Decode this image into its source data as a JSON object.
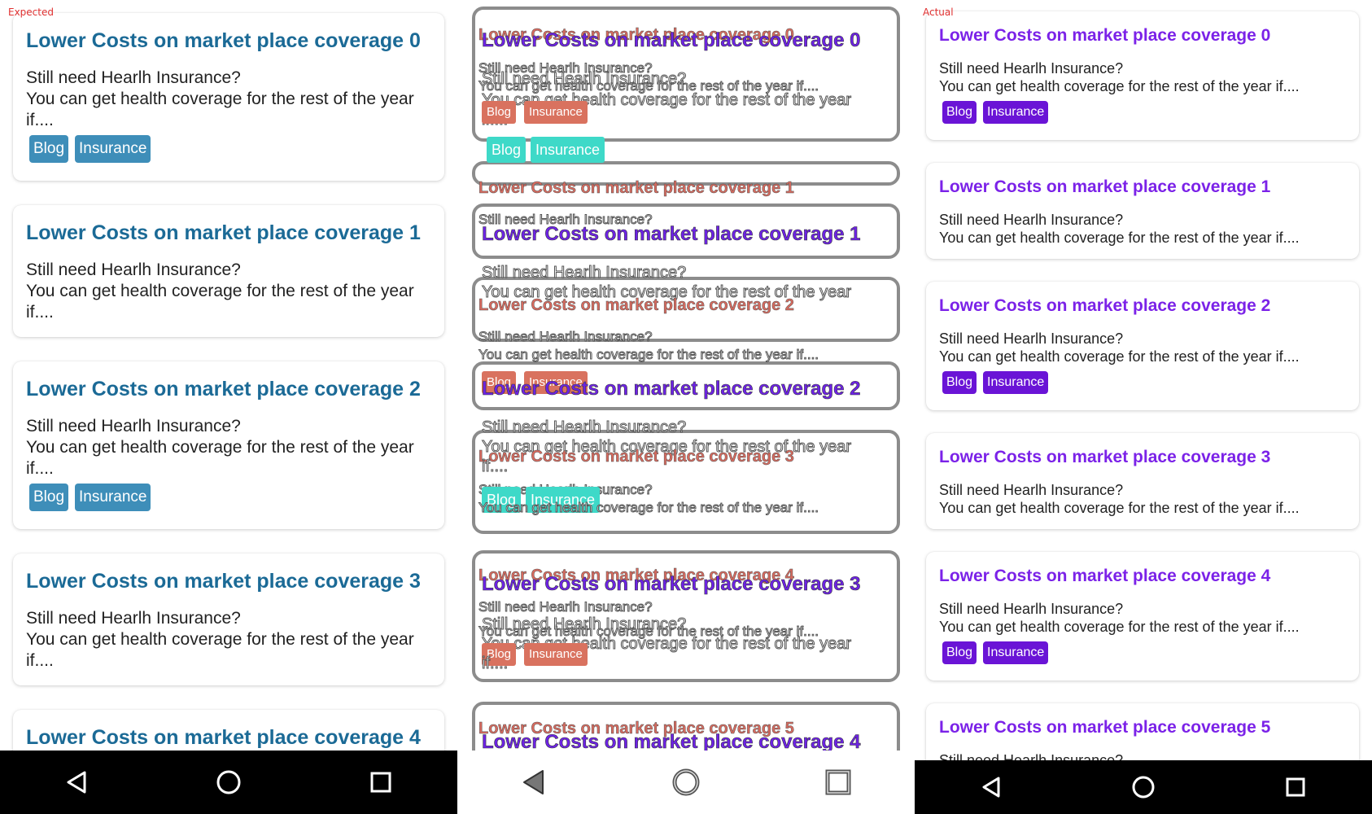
{
  "labels": {
    "expected": "Expected",
    "actual": "Actual"
  },
  "card_line1": "Still need Hearlh Insurance?",
  "card_line2_wrapped": "You can get health coverage for the rest of the year",
  "card_line2_end": "if....",
  "card_line2_full": "You can get health coverage for the rest of the year if....",
  "expected_cards": [
    {
      "title": "Lower Costs on market place coverage 0",
      "tags": [
        "Blog",
        "Insurance"
      ]
    },
    {
      "title": "Lower Costs on market place coverage 1",
      "tags": []
    },
    {
      "title": "Lower Costs on market place coverage 2",
      "tags": [
        "Blog",
        "Insurance"
      ]
    },
    {
      "title": "Lower Costs on market place coverage 3",
      "tags": []
    },
    {
      "title": "Lower Costs on market place coverage 4",
      "tags": []
    }
  ],
  "actual_cards": [
    {
      "title": "Lower Costs on market place coverage 0",
      "tags": [
        "Blog",
        "Insurance"
      ]
    },
    {
      "title": "Lower Costs on market place coverage 1",
      "tags": []
    },
    {
      "title": "Lower Costs on market place coverage 2",
      "tags": [
        "Blog",
        "Insurance"
      ]
    },
    {
      "title": "Lower Costs on market place coverage 3",
      "tags": []
    },
    {
      "title": "Lower Costs on market place coverage 4",
      "tags": [
        "Blog",
        "Insurance"
      ]
    },
    {
      "title": "Lower Costs on market place coverage 5",
      "tags": []
    }
  ],
  "tag_labels": {
    "blog": "Blog",
    "insurance": "Insurance"
  },
  "nav": {
    "back": "back-icon",
    "home": "home-icon",
    "recents": "recents-icon"
  },
  "colors": {
    "expected_title": "#1b6a96",
    "expected_tag": "#3e8eb9",
    "actual_title": "#7b22e8",
    "actual_tag": "#6a14d6",
    "diff_removed_tag": "#d9725f",
    "diff_added_tag": "#3ed9c8"
  }
}
